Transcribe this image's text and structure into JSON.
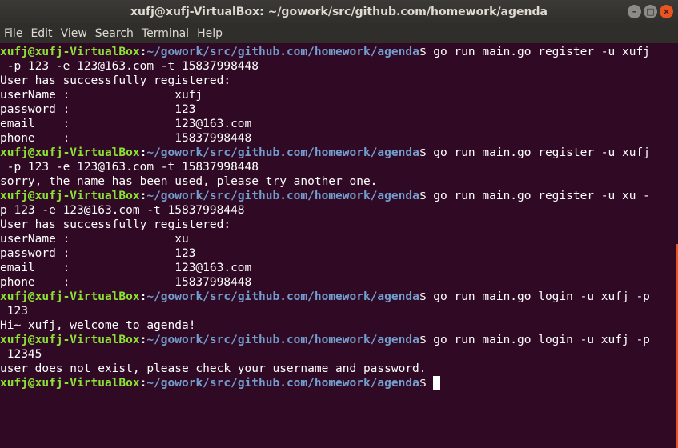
{
  "window": {
    "title": "xufj@xufj-VirtualBox: ~/gowork/src/github.com/homework/agenda",
    "controls": {
      "minimize": "–",
      "maximize": "□",
      "close": "×"
    }
  },
  "menu": [
    "File",
    "Edit",
    "View",
    "Search",
    "Terminal",
    "Help"
  ],
  "prompt": {
    "user_host": "xufj@xufj-VirtualBox",
    "colon": ":",
    "path": "~/gowork/src/github.com/homework/agenda",
    "dollar": "$"
  },
  "lines": [
    {
      "type": "prompt",
      "cmd": " go run main.go register -u xufj"
    },
    {
      "type": "output",
      "text": " -p 123 -e 123@163.com -t 15837998448"
    },
    {
      "type": "output",
      "text": "User has successfully registered:"
    },
    {
      "type": "output",
      "text": "userName :               xufj"
    },
    {
      "type": "output",
      "text": "password :               123"
    },
    {
      "type": "output",
      "text": "email    :               123@163.com"
    },
    {
      "type": "output",
      "text": "phone    :               15837998448"
    },
    {
      "type": "prompt",
      "cmd": " go run main.go register -u xufj"
    },
    {
      "type": "output",
      "text": " -p 123 -e 123@163.com -t 15837998448"
    },
    {
      "type": "output",
      "text": "sorry, the name has been used, please try another one."
    },
    {
      "type": "prompt",
      "cmd": " go run main.go register -u xu -"
    },
    {
      "type": "output",
      "text": "p 123 -e 123@163.com -t 15837998448"
    },
    {
      "type": "output",
      "text": "User has successfully registered:"
    },
    {
      "type": "output",
      "text": "userName :               xu"
    },
    {
      "type": "output",
      "text": "password :               123"
    },
    {
      "type": "output",
      "text": "email    :               123@163.com"
    },
    {
      "type": "output",
      "text": "phone    :               15837998448"
    },
    {
      "type": "prompt",
      "cmd": " go run main.go login -u xufj -p"
    },
    {
      "type": "output",
      "text": " 123"
    },
    {
      "type": "output",
      "text": "Hi~ xufj, welcome to agenda!"
    },
    {
      "type": "prompt",
      "cmd": " go run main.go login -u xufj -p"
    },
    {
      "type": "output",
      "text": " 12345"
    },
    {
      "type": "output",
      "text": "user does not exist, please check your username and password."
    },
    {
      "type": "prompt",
      "cmd": " ",
      "cursor": true
    }
  ],
  "colors": {
    "background": "#300a24",
    "prompt_user": "#8ae234",
    "prompt_path": "#729fcf",
    "text": "#ffffff"
  }
}
